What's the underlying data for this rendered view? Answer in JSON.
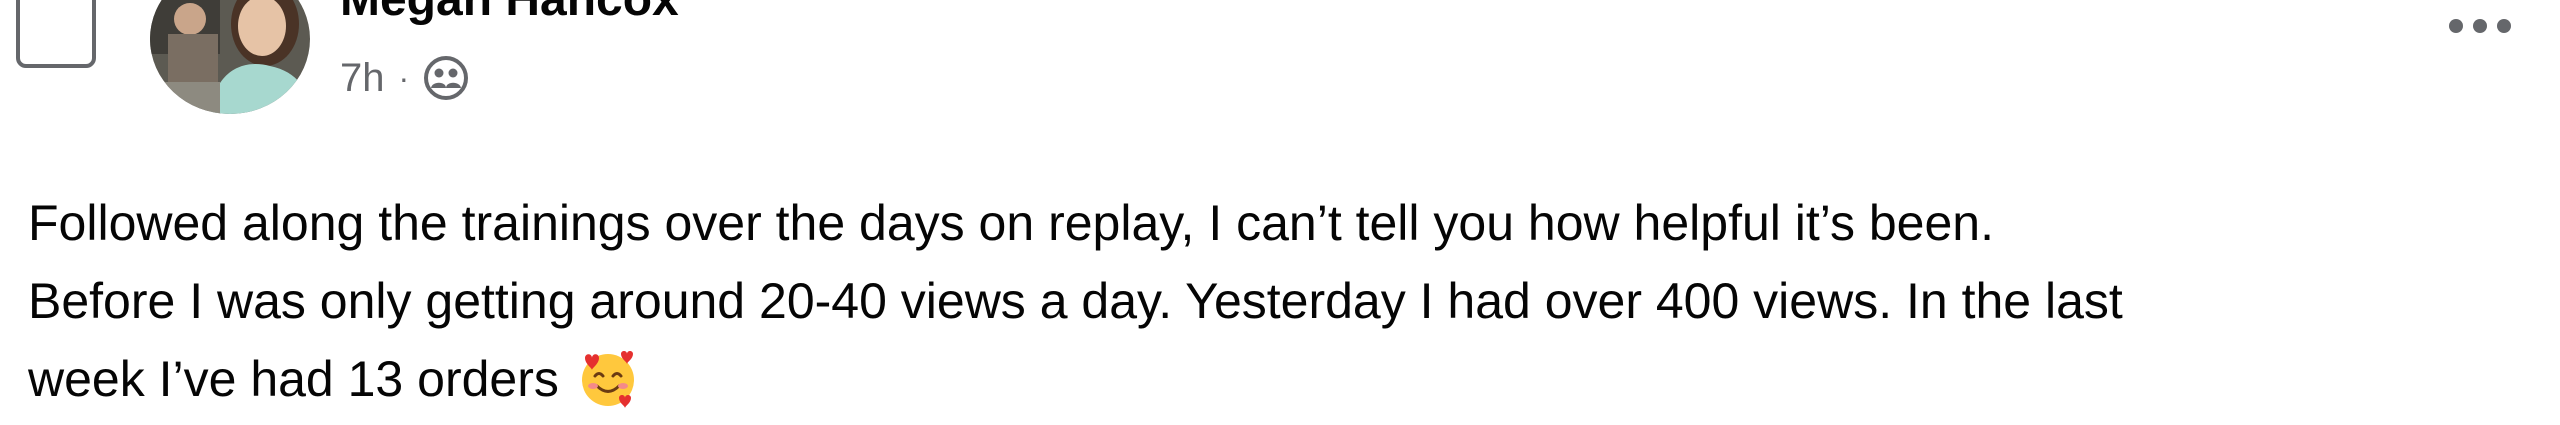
{
  "post": {
    "author": "Megan Hancox",
    "timestamp": "7h",
    "separator": "·",
    "audience_icon": "friends-icon",
    "more_icon": "ellipsis-icon",
    "avatar_icon": "profile-photo",
    "body_lines": [
      "Followed along the trainings over the days on replay, I can’t tell you how helpful it’s been.",
      "Before I was only getting around 20-40 views a day. Yesterday I had over 400 views. In the last",
      "week I’ve had 13 orders"
    ],
    "emoji": "smiling-face-with-hearts-emoji"
  },
  "colors": {
    "text_primary": "#050505",
    "text_secondary": "#65676b",
    "checkbox_border": "#65676b"
  }
}
